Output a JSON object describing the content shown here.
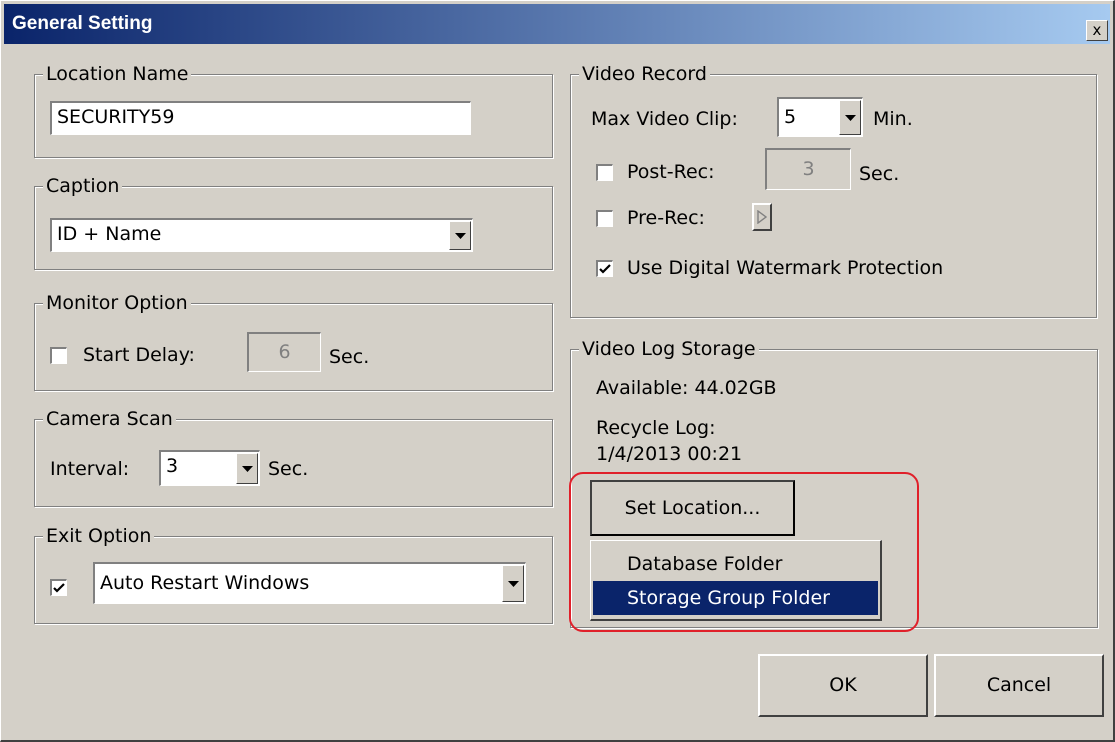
{
  "window": {
    "title": "General Setting",
    "close_glyph": "x"
  },
  "location_name": {
    "legend": "Location Name",
    "value": "SECURITY59"
  },
  "caption": {
    "legend": "Caption",
    "value": "ID + Name"
  },
  "monitor_option": {
    "legend": "Monitor Option",
    "start_delay_label": "Start Delay:",
    "start_delay_checked": false,
    "start_delay_value": "6",
    "unit": "Sec."
  },
  "camera_scan": {
    "legend": "Camera Scan",
    "interval_label": "Interval:",
    "interval_value": "3",
    "unit": "Sec."
  },
  "exit_option": {
    "legend": "Exit Option",
    "checked": true,
    "value": "Auto Restart Windows"
  },
  "video_record": {
    "legend": "Video Record",
    "max_clip_label": "Max Video Clip:",
    "max_clip_value": "5",
    "max_clip_unit": "Min.",
    "post_rec_label": "Post-Rec:",
    "post_rec_checked": false,
    "post_rec_value": "3",
    "post_rec_unit": "Sec.",
    "pre_rec_label": "Pre-Rec:",
    "pre_rec_checked": false,
    "watermark_label": "Use Digital Watermark Protection",
    "watermark_checked": true
  },
  "video_log_storage": {
    "legend": "Video Log Storage",
    "available": "Available: 44.02GB",
    "recycle_label": "Recycle Log:",
    "recycle_date": "1/4/2013 00:21",
    "set_location_label": "Set Location...",
    "menu_items": [
      "Database Folder",
      "Storage Group Folder"
    ],
    "selected_menu_item": "Storage Group Folder"
  },
  "buttons": {
    "ok": "OK",
    "cancel": "Cancel"
  },
  "colors": {
    "face": "#d4d0c8",
    "title_start": "#0a246a",
    "title_end": "#a6caf0",
    "selection": "#0a246a",
    "highlight_outline": "#e0202a"
  },
  "icons": [
    "close-icon",
    "dropdown-arrow-icon",
    "checkmark-icon",
    "play-arrow-icon"
  ]
}
